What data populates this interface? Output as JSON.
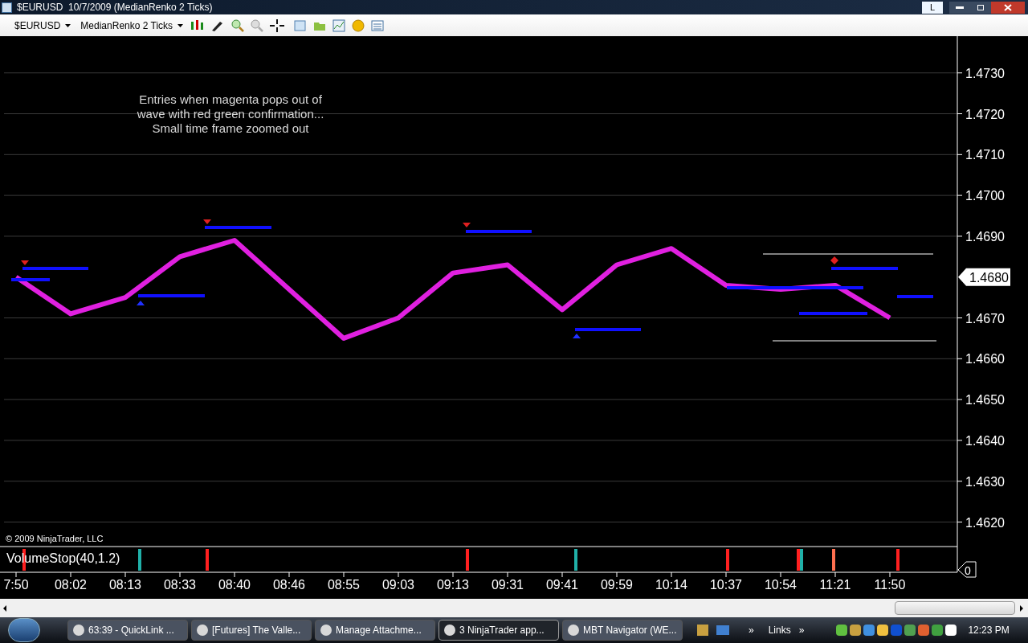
{
  "window": {
    "title": "$EURUSD  10/7/2009 (MedianRenko 2 Ticks)",
    "layout_button": "L"
  },
  "toolbar": {
    "instrument": "$EURUSD",
    "period": "MedianRenko 2 Ticks"
  },
  "chart": {
    "annotation": [
      "Entries when magenta pops out of",
      "wave with red green confirmation...",
      "Small time frame zoomed out"
    ],
    "copyright": "© 2009 NinjaTrader, LLC",
    "price_marker": "1.4680",
    "indicator": {
      "label": "VolumeStop(40,1.2)",
      "value": "0"
    },
    "chart_data": {
      "type": "line",
      "grid": true,
      "x": [
        "7:50",
        "08:02",
        "08:13",
        "08:33",
        "08:40",
        "08:46",
        "08:55",
        "09:03",
        "09:13",
        "09:31",
        "09:41",
        "09:59",
        "10:14",
        "10:37",
        "10:54",
        "11:21",
        "11:50"
      ],
      "values": [
        1.468,
        1.4671,
        1.4675,
        1.4685,
        1.4689,
        1.4677,
        1.4665,
        1.467,
        1.4681,
        1.4683,
        1.4672,
        1.4683,
        1.4687,
        1.4678,
        1.4677,
        1.4678,
        1.467
      ],
      "ylim": [
        1.4614,
        1.4739
      ],
      "yticks": [
        {
          "value": 1.473,
          "label": "1.4730"
        },
        {
          "value": 1.472,
          "label": "1.4720"
        },
        {
          "value": 1.471,
          "label": "1.4710"
        },
        {
          "value": 1.47,
          "label": "1.4700"
        },
        {
          "value": 1.469,
          "label": "1.4690"
        },
        {
          "value": 1.467,
          "label": "1.4670"
        },
        {
          "value": 1.466,
          "label": "1.4660"
        },
        {
          "value": 1.465,
          "label": "1.4650"
        },
        {
          "value": 1.464,
          "label": "1.4640"
        },
        {
          "value": 1.463,
          "label": "1.4630"
        },
        {
          "value": 1.462,
          "label": "1.4620"
        }
      ]
    }
  },
  "taskbar": {
    "items": [
      {
        "label": "63:39 - QuickLink ...",
        "selected": false
      },
      {
        "label": "[Futures] The Valle...",
        "selected": false
      },
      {
        "label": "Manage Attachme...",
        "selected": false
      },
      {
        "label": "3 NinjaTrader app...",
        "selected": true
      },
      {
        "label": "MBT Navigator (WE...",
        "selected": false
      }
    ],
    "chevron": "»",
    "links": "Links",
    "links_chevron": "»",
    "clock": "12:23 PM"
  }
}
